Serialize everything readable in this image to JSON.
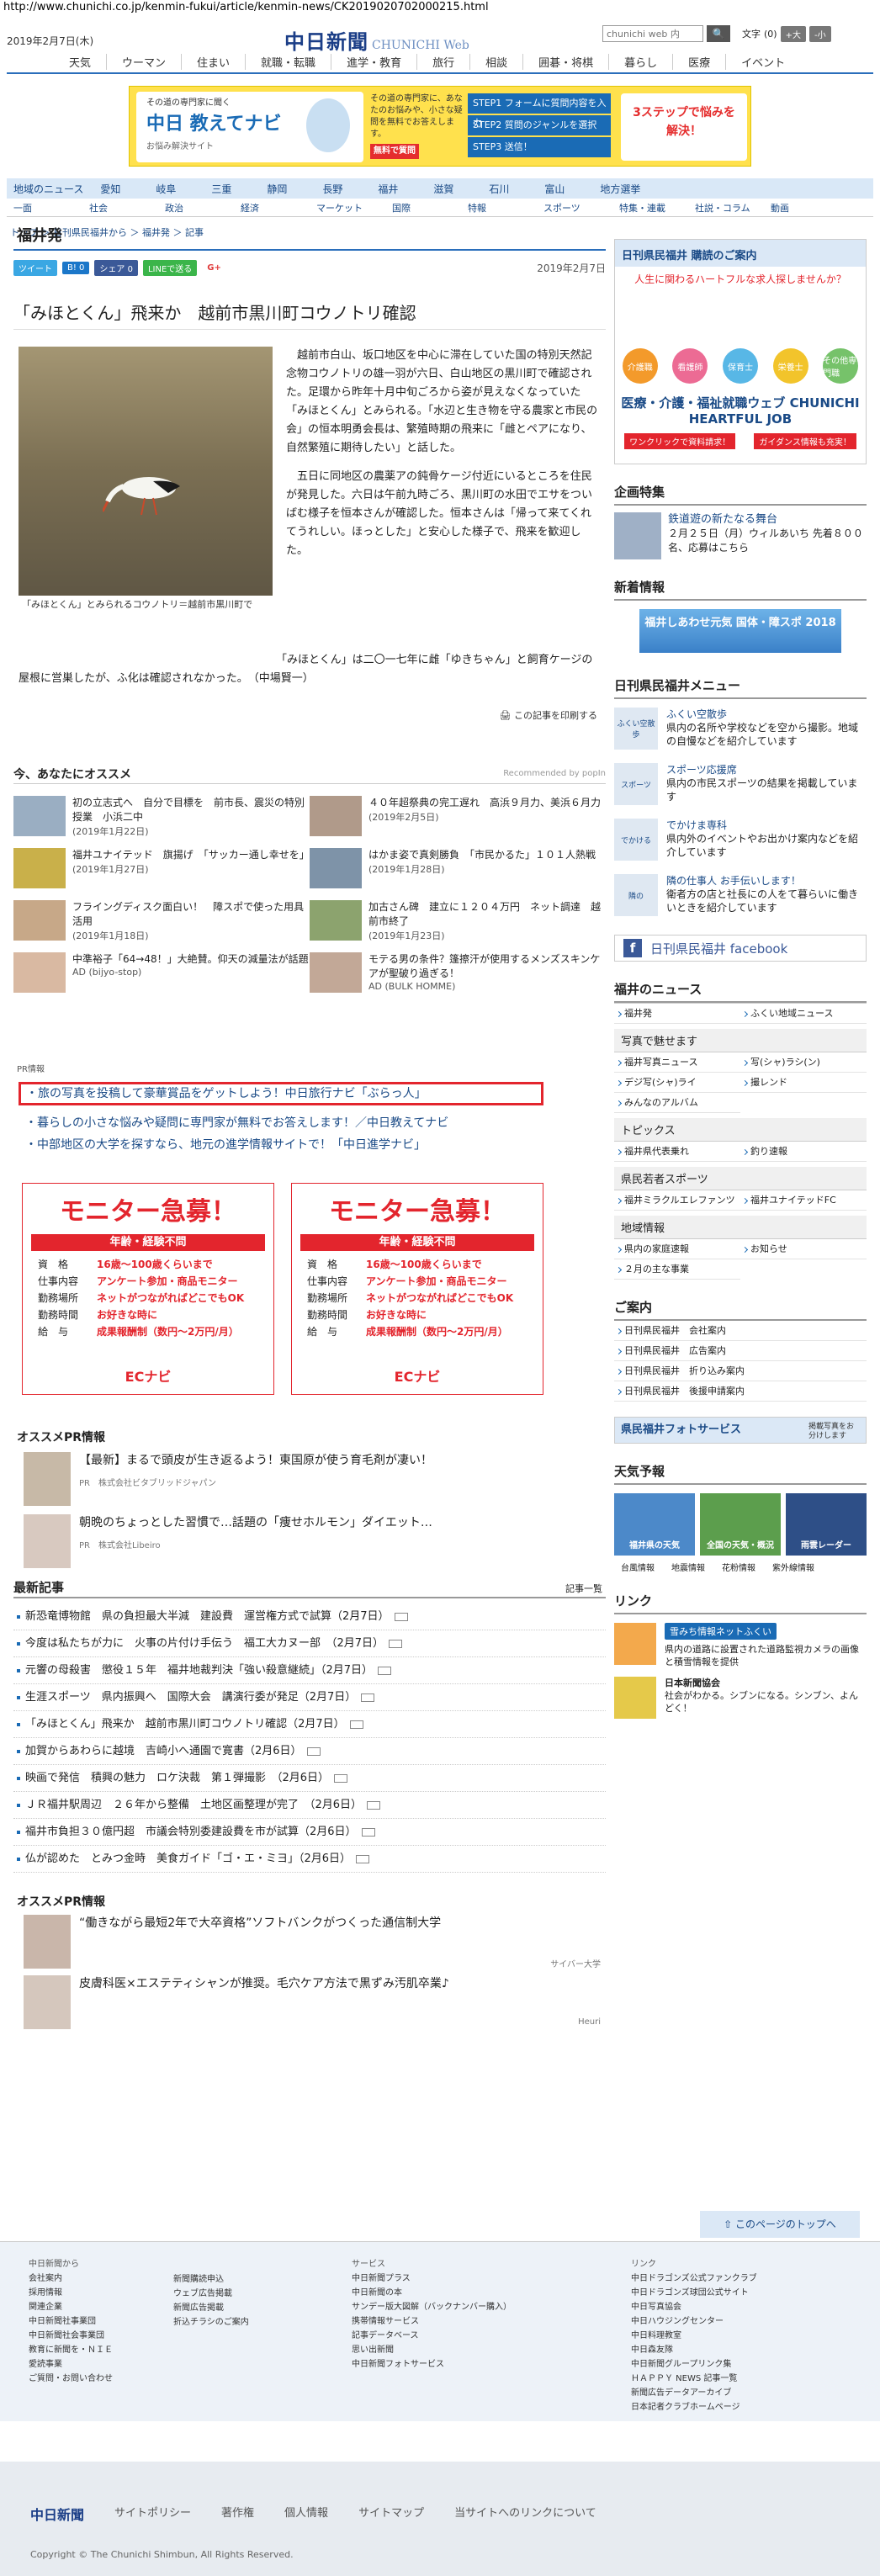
{
  "url": "http://www.chunichi.co.jp/kenmin-fukui/article/kenmin-news/CK2019020702000215.html",
  "header": {
    "date": "2019年2月7日(木)",
    "logo_main": "中日新聞",
    "logo_sub": "CHUNICHI Web",
    "search_placeholder": "chunichi web 内",
    "search_btn": "🔍",
    "font_label": "文字",
    "font_level": "(0)",
    "font_big": "+大",
    "font_small": "-小"
  },
  "gnav": [
    "天気",
    "ウーマン",
    "住まい",
    "就職・転職",
    "進学・教育",
    "旅行",
    "相談",
    "囲碁・将棋",
    "暮らし",
    "医療",
    "イベント"
  ],
  "banner": {
    "line1": "その道の専門家に聞く",
    "title": "中日 教えてナビ",
    "line3": "お悩み解決サイト",
    "mid": "その道の専門家に、あなたのお悩みや、小さな疑問を無料でお答えします。",
    "free": "無料で質問",
    "steps": [
      "STEP1 フォームに質問内容を入力",
      "STEP2 質問のジャンルを選択",
      "STEP3 送信！"
    ],
    "right": "3ステップで悩みを解決！"
  },
  "region_nav": [
    "地域のニュース",
    "愛知",
    "岐阜",
    "三重",
    "静岡",
    "長野",
    "福井",
    "滋賀",
    "石川",
    "富山",
    "地方選挙"
  ],
  "section_nav": [
    "一面",
    "社会",
    "政治",
    "経済",
    "マーケット",
    "国際",
    "特報",
    "スポーツ",
    "特集・連載",
    "社説・コラム",
    "動画"
  ],
  "breadcrumb": "トップ ＞ 日刊県民福井から ＞ 福井発 ＞ 記事",
  "area_title": "福井発",
  "share": {
    "tweet": "ツイート",
    "hatena": "B! 0",
    "fb": "シェア 0",
    "line": "LINEで送る",
    "gplus": "G+"
  },
  "article": {
    "date": "2019年2月7日",
    "title": "「みほとくん」飛来か　越前市黒川町コウノトリ確認",
    "photo_caption": "「みほとくん」とみられるコウノトリ＝越前市黒川町で",
    "p1": "越前市白山、坂口地区を中心に滞在していた国の特別天然記念物コウノトリの雄一羽が六日、白山地区の黒川町で確認された。足環から昨年十月中旬ごろから姿が見えなくなっていた「みほとくん」とみられる。「水辺と生き物を守る農家と市民の会」の恒本明勇会長は、繁殖時期の飛来に「雌とペアになり、自然繁殖に期待したい」と話した。",
    "p2": "五日に同地区の農薬アの鈍骨ケージ付近にいるところを住民が発見した。六日は午前九時ごろ、黒川町の水田でエサをついばむ様子を恒本さんが確認した。恒本さんは「帰って来てくれてうれしい。ほっとした」と安心した様子で、飛来を歓迎した。",
    "p3": "「みほとくん」は二〇一七年に雌「ゆきちゃん」と飼育ケージの屋根に営巣したが、ふ化は確認されなかった。　（中場賢一）",
    "print": "この記事を印刷する"
  },
  "recommend": {
    "title": "今、あなたにオススメ",
    "powered": "Recommended by popIn",
    "items": [
      {
        "title": "初の立志式へ　自分で目標を　前市長、震災の特別授業　小浜二中",
        "date": "(2019年1月22日)"
      },
      {
        "title": "４０年超祭典の完工遅れ　高浜９月力、美浜６月力",
        "date": "(2019年2月5日)"
      },
      {
        "title": "福井ユナイテッド　旗揚げ　「サッカー通し幸せを」",
        "date": "(2019年1月27日)"
      },
      {
        "title": "はかま姿で真剣勝負　「市民かるた」１０１人熱戦",
        "date": "(2019年1月28日)"
      },
      {
        "title": "フライングディスク面白い！　障スポで使った用具活用",
        "date": "(2019年1月18日)"
      },
      {
        "title": "加古さん碑　建立に１２０４万円　ネット調達　越前市終了",
        "date": "(2019年1月23日)"
      },
      {
        "title": "中準裕子「64→48！」大絶賛。仰天の減量法が話題",
        "date": "AD (bijyo-stop)"
      },
      {
        "title": "モテる男の条件？篷擦汗が使用するメンズスキンケアが聖破り過ぎる！",
        "date": "AD (BULK HOMME)"
      }
    ]
  },
  "pr": {
    "label": "PR情報",
    "l1": "・旅の写真を投稿して豪華賞品をゲットしよう！中日旅行ナビ「ぶらっ人」",
    "l2": "・暮らしの小さな悩みや疑問に専門家が無料でお答えします！／中日教えてナビ",
    "l3": "・中部地区の大学を探すなら、地元の進学情報サイトで！「中日進学ナビ」"
  },
  "ec_ads": [
    {
      "title": "モニター急募！",
      "band": "年齢・経験不問",
      "r1k": "資　格",
      "r1v": "16歳～100歳くらいまで",
      "r2k": "仕事内容",
      "r2v": "アンケート参加・商品モニター",
      "r3k": "勤務場所",
      "r3v": "ネットがつながればどこでもOK",
      "r4k": "勤務時間",
      "r4v": "お好きな時に",
      "r5k": "給　与",
      "r5v": "成果報酬制（数円～2万円/月）",
      "logo": "ECナビ"
    },
    {
      "title": "モニター急募！",
      "band": "年齢・経験不問",
      "r1k": "資　格",
      "r1v": "16歳～100歳くらいまで",
      "r2k": "仕事内容",
      "r2v": "アンケート参加・商品モニター",
      "r3k": "勤務場所",
      "r3v": "ネットがつながればどこでもOK",
      "r4k": "勤務時間",
      "r4v": "お好きな時に",
      "r5k": "給　与",
      "r5v": "成果報酬制（数円～2万円/月）",
      "logo": "ECナビ"
    }
  ],
  "ospr1": {
    "title": "オススメPR情報",
    "items": [
      {
        "text": "【最新】まるで頭皮が生き返るよう！東国原が使う育毛剤が凄い！",
        "src": "PR　株式会社ビタブリッドジャパン"
      },
      {
        "text": "朝晩のちょっとした習慣で…話題の「痩せホルモン」ダイエット…",
        "src": "PR　株式会社Libeiro"
      }
    ]
  },
  "news": {
    "title": "最新記事",
    "more": "記事一覧",
    "items": [
      "新恐竜博物館　県の負担最大半減　建設費　運営権方式で試算（2月7日）",
      "今度は私たちが力に　火事の片付け手伝う　福工大カヌー部　（2月7日）",
      "元響の母殺害　懲役１５年　福井地裁判決「強い殺意継続」（2月7日）",
      "生涯スポーツ　県内振興へ　国際大会　講演行委が発足（2月7日）",
      "「みほとくん」飛来か　越前市黒川町コウノトリ確認（2月7日）",
      "加賀からあわらに越境　吉崎小へ通園で寛書（2月6日）",
      "映画で発信　積興の魅力　ロケ決裁　第１弾撮影　（2月6日）",
      "ＪＲ福井駅周辺　２６年から整備　土地区画整理が完了　（2月6日）",
      "福井市負担３０億円超　市議会特別委建設費を市が試算（2月6日）",
      "仏が認めた　とみつ金時　美食ガイド「ゴ・エ・ミヨ」（2月6日）"
    ]
  },
  "ospr2": {
    "title": "オススメPR情報",
    "items": [
      {
        "text": "“働きながら最短2年で大卒資格”ソフトバンクがつくった通信制大学",
        "src": "サイバー大学"
      },
      {
        "text": "皮膚科医×エステティシャンが推奨。毛穴ケア方法で黒ずみ汚肌卒業♪",
        "src": "Heuri"
      }
    ]
  },
  "side": {
    "kodoku_hd": "日刊県民福井 購読のご案内",
    "kodoku_sub": "人生に関わるハートフルな求人探しませんか？",
    "kodoku_hearts": [
      "介護職",
      "看護師",
      "保育士",
      "栄養士",
      "その他専門職"
    ],
    "kodoku_hj": "医療・介護・福祉就職ウェブ CHUNICHI HEARTFUL JOB",
    "kodoku_btns": [
      "ワンクリックで資料請求！",
      "ガイダンス情報も充実！"
    ],
    "kikaku_hd": "企画特集",
    "kikaku_tt": "鉄道遊の新たなる舞台",
    "kikaku_dt": "２月２５日（月）ウィルあいち 先着８００名、応募はこちら",
    "shinchaku_hd": "新着情報",
    "shinchaku_bn": "福井しあわせ元気 国体・障スポ 2018",
    "menu_hd": "日刊県民福井メニュー",
    "menu": [
      {
        "icon": "ふくい空散歩",
        "title": "ふくい空散歩",
        "desc": "県内の名所や学校などを空から撮影。地域の自慢などを紹介しています"
      },
      {
        "icon": "スポーツ",
        "title": "スポーツ応援席",
        "desc": "県内の市民スポーツの結果を掲載しています"
      },
      {
        "icon": "でかける",
        "title": "でかけま専科",
        "desc": "県内外のイベントやお出かけ案内などを紹介しています"
      },
      {
        "icon": "隣の",
        "title": "隣の仕事人 お手伝いします！",
        "desc": "衛者方の店と社長にの人をて暮らいに働きいときを紹介しています"
      }
    ],
    "fb": "日刊県民福井 facebook",
    "news_hd": "福井のニュース",
    "news_grid": [
      "福井発",
      "ふくい地域ニュース"
    ],
    "photo_hd": "写真で魅せます",
    "photo_grid": [
      "福井写真ニュース",
      "写(シャ)ラシ(ン)",
      "デジ写(シャ)ライ",
      "撮レンド",
      "みんなのアルバム"
    ],
    "topics_hd": "トピックス",
    "topics_grid": [
      "福井県代表乗れ",
      "釣り速報"
    ],
    "sports_hd": "県民若者スポーツ",
    "sports_grid": [
      "福井ミラクルエレファンツ",
      "福井ユナイテッドFC"
    ],
    "chiiki_hd": "地域情報",
    "chiiki_grid": [
      "県内の家庭速報",
      "お知らせ",
      "２月の主な事業"
    ],
    "annai_hd": "ご案内",
    "annai": [
      "日刊県民福井　会社案内",
      "日刊県民福井　広告案内",
      "日刊県民福井　折り込み案内",
      "日刊県民福井　後援申請案内"
    ],
    "photo_srv": "県民福井フォトサービス",
    "photo_srv_sub": "掲載写真をお分けします",
    "weather_hd": "天気予報",
    "weather": [
      "福井県の天気",
      "全国の天気・概況",
      "雨雲レーダー"
    ],
    "weather_links": [
      "台風情報",
      "地震情報",
      "花粉情報",
      "紫外線情報"
    ],
    "link_hd": "リンク",
    "link1_bn": "雪みち情報ネットふくい",
    "link1_tt": "県内の道路に設置された道路監視カメラの画像と積雪情報を提供",
    "link2_tt": "日本新聞協会",
    "link2_dt": "社会がわかる。シブンになる。シンブン、よんどく！"
  },
  "totop": "このページのトップへ",
  "footer": {
    "col1": [
      "中日新聞から",
      "会社案内",
      "採用情報",
      "関連企業",
      "中日新聞社事業団",
      "中日新聞社会事業団",
      "教育に新聞を・ＮＩＥ",
      "愛読事業",
      "ご質問・お問い合わせ"
    ],
    "col2": [
      "新聞購読申込",
      "ウェブ広告掲載",
      "新聞広告掲載",
      "折込チラシのご案内"
    ],
    "col3": [
      "サービス",
      "中日新聞プラス",
      "中日新聞の本",
      "サンデー版大図解（バックナンバー購入）",
      "携帯情報サービス",
      "記事データベース",
      "思い出新聞",
      "中日新聞フォトサービス"
    ],
    "col4": [
      "リンク",
      "中日ドラゴンズ公式ファンクラブ",
      "中日ドラゴンズ球団公式サイト",
      "中日写真協会",
      "中日ハウジングセンター",
      "中日料理教室",
      "中日森友隊",
      "中日新聞グループリンク集",
      "ＨＡＰＰＹ NEWS 記事一覧",
      "新聞広告データアーカイブ",
      "日本記者クラブホームページ"
    ],
    "nav_logo": "中日新聞",
    "nav": [
      "サイトポリシー",
      "著作権",
      "個人情報",
      "サイトマップ",
      "当サイトへのリンクについて"
    ],
    "copy": "Copyright © The Chunichi Shimbun, All Rights Reserved."
  }
}
